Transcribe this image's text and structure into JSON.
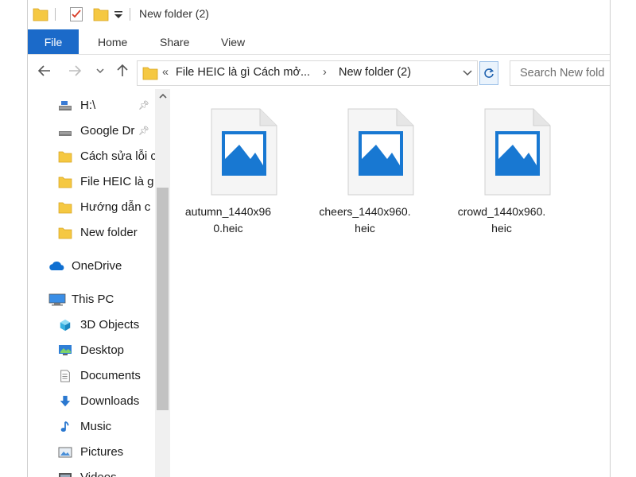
{
  "window": {
    "title": "New folder (2)"
  },
  "ribbon": {
    "file": "File",
    "home": "Home",
    "share": "Share",
    "view": "View"
  },
  "address": {
    "prefix": "«",
    "crumb1": "File HEIC là gì Cách mở...",
    "crumb2": "New folder (2)",
    "sep": "›"
  },
  "search": {
    "placeholder": "Search New fold"
  },
  "nav": {
    "items": [
      {
        "label": "H:\\",
        "icon": "drive-icon",
        "pinned": true
      },
      {
        "label": "Google Dr",
        "icon": "drive-icon",
        "pinned": true
      },
      {
        "label": "Cách sửa lỗi c",
        "icon": "folder-icon",
        "pinned": false
      },
      {
        "label": "File HEIC là g",
        "icon": "folder-icon",
        "pinned": false
      },
      {
        "label": "Hướng dẫn c",
        "icon": "folder-icon",
        "pinned": false
      },
      {
        "label": "New folder",
        "icon": "folder-icon",
        "pinned": false
      },
      {
        "label": "OneDrive",
        "icon": "onedrive-icon",
        "pinned": false
      },
      {
        "label": "This PC",
        "icon": "pc-icon",
        "pinned": false
      },
      {
        "label": "3D Objects",
        "icon": "cube-icon",
        "pinned": false
      },
      {
        "label": "Desktop",
        "icon": "desktop-icon",
        "pinned": false
      },
      {
        "label": "Documents",
        "icon": "documents-icon",
        "pinned": false
      },
      {
        "label": "Downloads",
        "icon": "download-icon",
        "pinned": false
      },
      {
        "label": "Music",
        "icon": "music-icon",
        "pinned": false
      },
      {
        "label": "Pictures",
        "icon": "pictures-icon",
        "pinned": false
      },
      {
        "label": "Videos",
        "icon": "videos-icon",
        "pinned": false
      }
    ]
  },
  "files": [
    {
      "name_line1": "autumn_1440x96",
      "name_line2": "0.heic"
    },
    {
      "name_line1": "cheers_1440x960.",
      "name_line2": "heic"
    },
    {
      "name_line1": "crowd_1440x960.",
      "name_line2": "heic"
    }
  ],
  "colors": {
    "accent": "#1b6ac9",
    "image_blue": "#1878d2",
    "folder": "#f5c842"
  }
}
